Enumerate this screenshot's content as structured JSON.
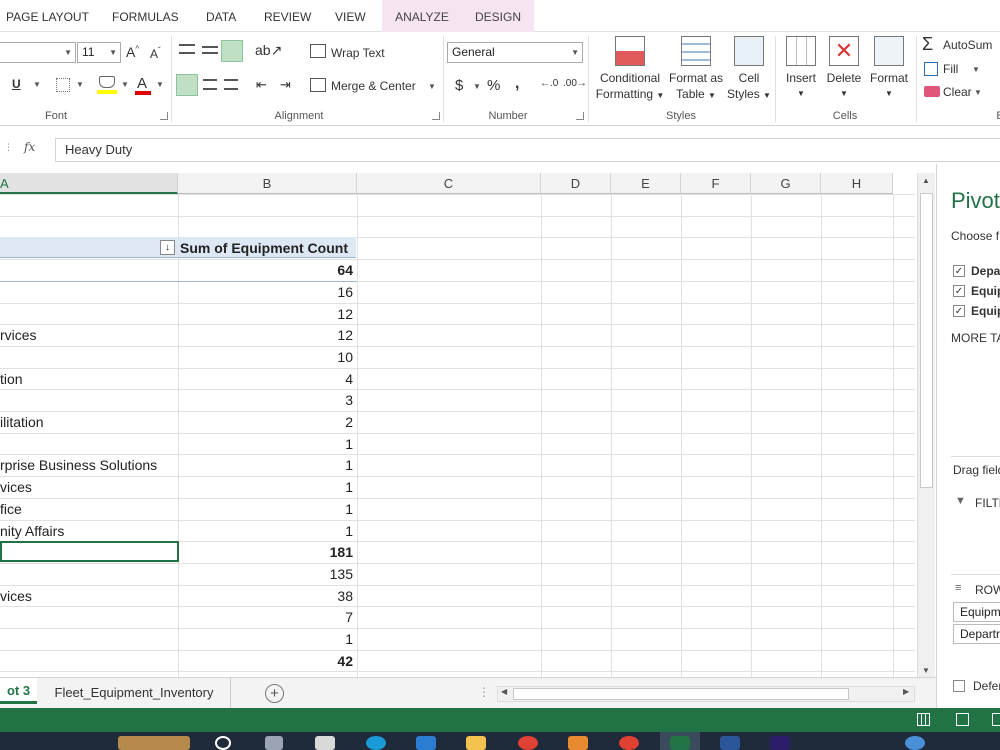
{
  "tabs": {
    "page_layout": "PAGE LAYOUT",
    "formulas": "FORMULAS",
    "data": "DATA",
    "review": "REVIEW",
    "view": "VIEW",
    "analyze": "ANALYZE",
    "design": "DESIGN"
  },
  "ribbon": {
    "font_size": "11",
    "groups": {
      "font": "Font",
      "alignment": "Alignment",
      "number": "Number",
      "styles": "Styles",
      "cells": "Cells"
    },
    "wrap_text": "Wrap Text",
    "merge_center": "Merge & Center",
    "number_format": "General",
    "currency": "$",
    "percent": "%",
    "comma": ",",
    "conditional_formatting": [
      "Conditional",
      "Formatting"
    ],
    "format_as_table": [
      "Format as",
      "Table"
    ],
    "cell_styles": [
      "Cell",
      "Styles"
    ],
    "insert": "Insert",
    "delete": "Delete",
    "format": "Format",
    "autosum": "AutoSum",
    "fill": "Fill",
    "clear": "Clear",
    "editing_clip": "E"
  },
  "formula_bar": {
    "fx": "fx",
    "value": "Heavy Duty"
  },
  "grid": {
    "columns": [
      "A",
      "B",
      "C",
      "D",
      "E",
      "F",
      "G",
      "H"
    ],
    "header_b": "Sum of Equipment Count",
    "rows": [
      {
        "a": "",
        "b": "64",
        "bold": true
      },
      {
        "a": "",
        "b": "16",
        "bold": false
      },
      {
        "a": "",
        "b": "12",
        "bold": false
      },
      {
        "a": "rvices",
        "b": "12",
        "bold": false
      },
      {
        "a": "",
        "b": "10",
        "bold": false
      },
      {
        "a": "tion",
        "b": "4",
        "bold": false
      },
      {
        "a": "",
        "b": "3",
        "bold": false
      },
      {
        "a": "ilitation",
        "b": "2",
        "bold": false
      },
      {
        "a": "",
        "b": "1",
        "bold": false
      },
      {
        "a": "rprise Business Solutions",
        "b": "1",
        "bold": false
      },
      {
        "a": "vices",
        "b": "1",
        "bold": false
      },
      {
        "a": "fice",
        "b": "1",
        "bold": false
      },
      {
        "a": "nity Affairs",
        "b": "1",
        "bold": false
      },
      {
        "a": "",
        "b": "181",
        "bold": true
      },
      {
        "a": "",
        "b": "135",
        "bold": false
      },
      {
        "a": "vices",
        "b": "38",
        "bold": false
      },
      {
        "a": "",
        "b": "7",
        "bold": false
      },
      {
        "a": "",
        "b": "1",
        "bold": false
      },
      {
        "a": "",
        "b": "42",
        "bold": true
      }
    ]
  },
  "pivot_pane": {
    "title": "Pivot",
    "choose": "Choose f",
    "fields": [
      "Depa",
      "Equip",
      "Equip"
    ],
    "more": "MORE TA",
    "drag": "Drag field",
    "filters": "FILTE",
    "rows": "ROW",
    "row_items": [
      "Equipm",
      "Departr"
    ],
    "defer": "Defer"
  },
  "sheets": {
    "active": "ot 3",
    "other": "Fleet_Equipment_Inventory",
    "add": "+"
  },
  "colors": {
    "accent": "#217346",
    "ctx_tab": "#f6e4f0"
  }
}
